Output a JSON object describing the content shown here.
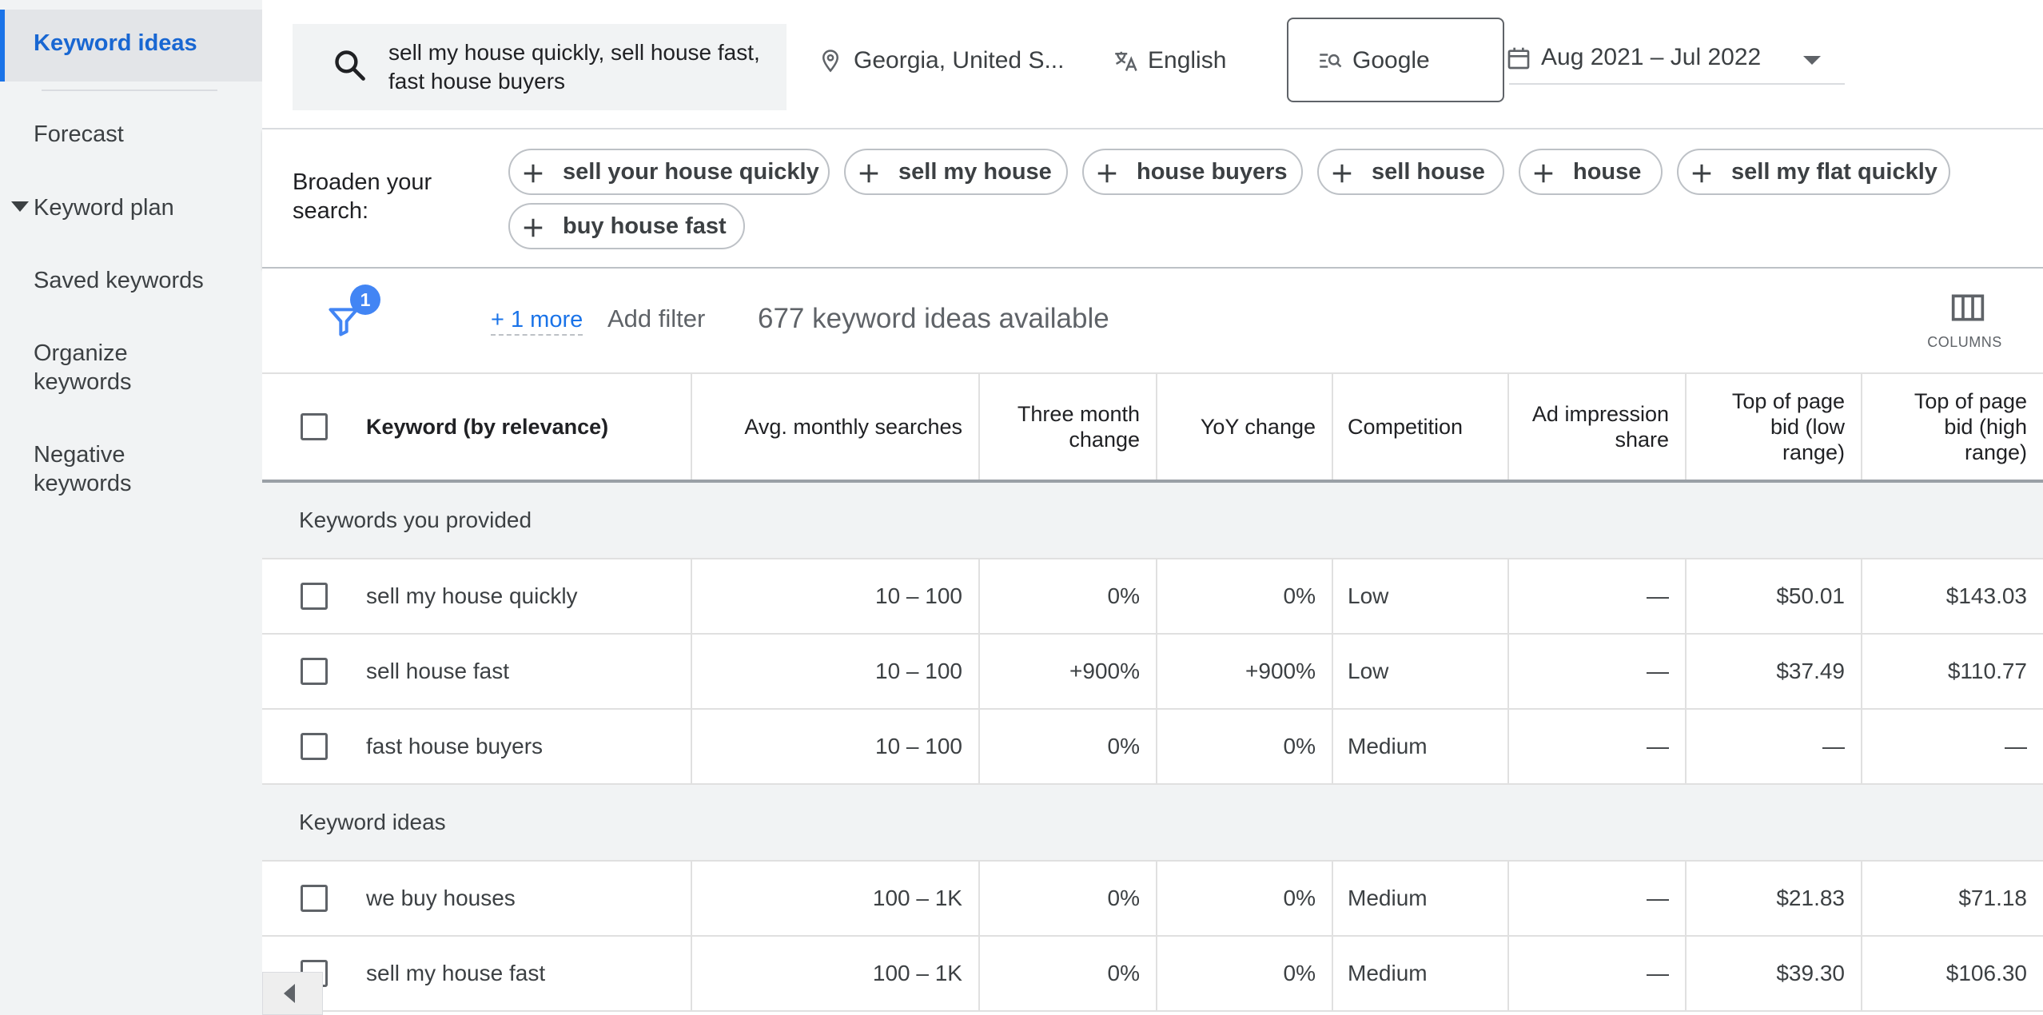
{
  "sidebar": {
    "items": [
      {
        "label": "Keyword ideas"
      },
      {
        "label": "Forecast"
      },
      {
        "label": "Keyword plan"
      },
      {
        "label": "Saved keywords"
      },
      {
        "label": "Organize keywords"
      },
      {
        "label": "Negative keywords"
      }
    ],
    "active_index": 0
  },
  "search": {
    "query": "sell my house quickly, sell house fast, fast house buyers",
    "location": "Georgia, United S...",
    "language": "English",
    "network": "Google",
    "date_range": "Aug 2021 – Jul 2022"
  },
  "broaden": {
    "label": "Broaden your search:",
    "chips": [
      "sell your house quickly",
      "sell my house",
      "house buyers",
      "sell house",
      "house",
      "sell my flat quickly",
      "buy house fast"
    ]
  },
  "filters": {
    "badge_count": "1",
    "more_link": "+ 1 more",
    "add_filter": "Add filter",
    "ideas_available": "677 keyword ideas available",
    "columns_label": "COLUMNS"
  },
  "table": {
    "headers": [
      "Keyword (by relevance)",
      "Avg. monthly searches",
      "Three month change",
      "YoY change",
      "Competition",
      "Ad impression share",
      "Top of page bid (low range)",
      "Top of page bid (high range)"
    ],
    "groups": [
      {
        "label": "Keywords you provided",
        "rows": [
          [
            "sell my house quickly",
            "10 – 100",
            "0%",
            "0%",
            "Low",
            "—",
            "$50.01",
            "$143.03"
          ],
          [
            "sell house fast",
            "10 – 100",
            "+900%",
            "+900%",
            "Low",
            "—",
            "$37.49",
            "$110.77"
          ],
          [
            "fast house buyers",
            "10 – 100",
            "0%",
            "0%",
            "Medium",
            "—",
            "—",
            "—"
          ]
        ]
      },
      {
        "label": "Keyword ideas",
        "rows": [
          [
            "we buy houses",
            "100 – 1K",
            "0%",
            "0%",
            "Medium",
            "—",
            "$21.83",
            "$71.18"
          ],
          [
            "sell my house fast",
            "100 – 1K",
            "0%",
            "0%",
            "Medium",
            "—",
            "$39.30",
            "$106.30"
          ]
        ]
      }
    ]
  }
}
